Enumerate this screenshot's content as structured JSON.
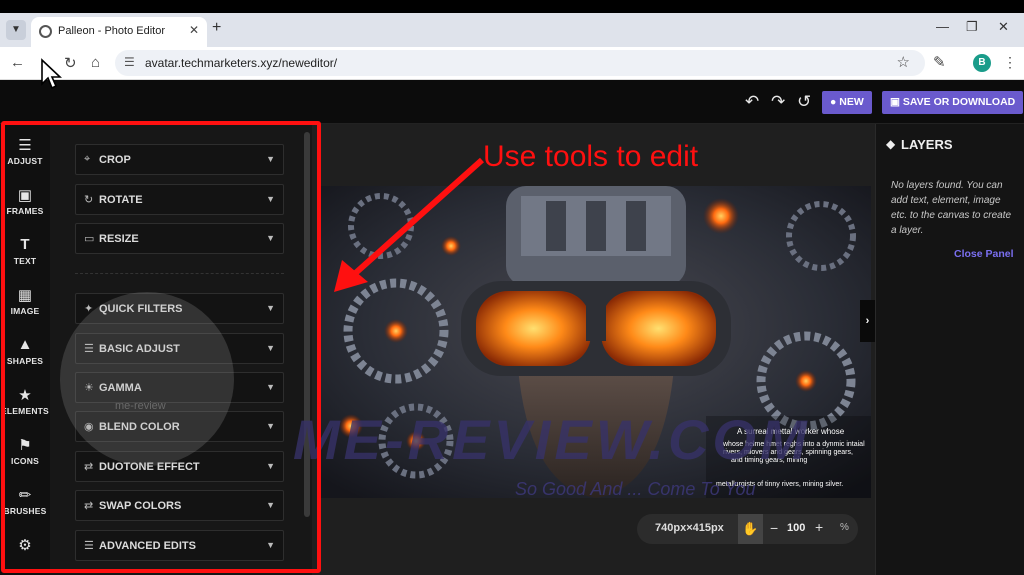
{
  "browser": {
    "tab_title": "Palleon - Photo Editor",
    "url": "avatar.techmarketers.xyz/neweditor/",
    "profile_initial": "B"
  },
  "header": {
    "new_label": "NEW",
    "save_label": "SAVE OR DOWNLOAD"
  },
  "rail": [
    {
      "label": "ADJUST",
      "icon": "sliders-icon"
    },
    {
      "label": "FRAMES",
      "icon": "frames-icon"
    },
    {
      "label": "TEXT",
      "icon": "text-icon"
    },
    {
      "label": "IMAGE",
      "icon": "image-icon"
    },
    {
      "label": "SHAPES",
      "icon": "shapes-icon"
    },
    {
      "label": "ELEMENTS",
      "icon": "star-icon"
    },
    {
      "label": "ICONS",
      "icon": "pin-icon"
    },
    {
      "label": "BRUSHES",
      "icon": "brush-icon"
    },
    {
      "label": "",
      "icon": "gear-icon"
    }
  ],
  "panel": {
    "items": [
      {
        "label": "CROP",
        "icon": "crop-icon"
      },
      {
        "label": "ROTATE",
        "icon": "rotate-icon"
      },
      {
        "label": "RESIZE",
        "icon": "resize-icon"
      },
      {
        "label": "QUICK FILTERS",
        "icon": "wand-icon"
      },
      {
        "label": "BASIC ADJUST",
        "icon": "sliders-icon"
      },
      {
        "label": "GAMMA",
        "icon": "sun-icon"
      },
      {
        "label": "BLEND COLOR",
        "icon": "palette-icon"
      },
      {
        "label": "DUOTONE EFFECT",
        "icon": "swap-icon"
      },
      {
        "label": "SWAP COLORS",
        "icon": "swap-icon"
      },
      {
        "label": "ADVANCED EDITS",
        "icon": "sliders-icon"
      }
    ]
  },
  "annotation": "Use tools to edit",
  "photo_text": {
    "title": "A surreal mettal worker whose",
    "line1": "whose helme hmet reghs into a dynmic intaial",
    "line2": "rivers, mlovers and gears, spinning gears,",
    "line3": "and timing gears, mining",
    "line4": "metallurgists of tinny rivers, mining silver."
  },
  "zoom": {
    "size": "740px×415px",
    "value": "100",
    "percent": "%"
  },
  "layers": {
    "title": "LAYERS",
    "message": "No layers found. You can add text, element, image etc. to the canvas to create a layer.",
    "close": "Close Panel"
  },
  "watermark": {
    "text": "ME-REVIEW.COM",
    "slogan": "So Good And ... Come To You",
    "small": "me-review"
  }
}
